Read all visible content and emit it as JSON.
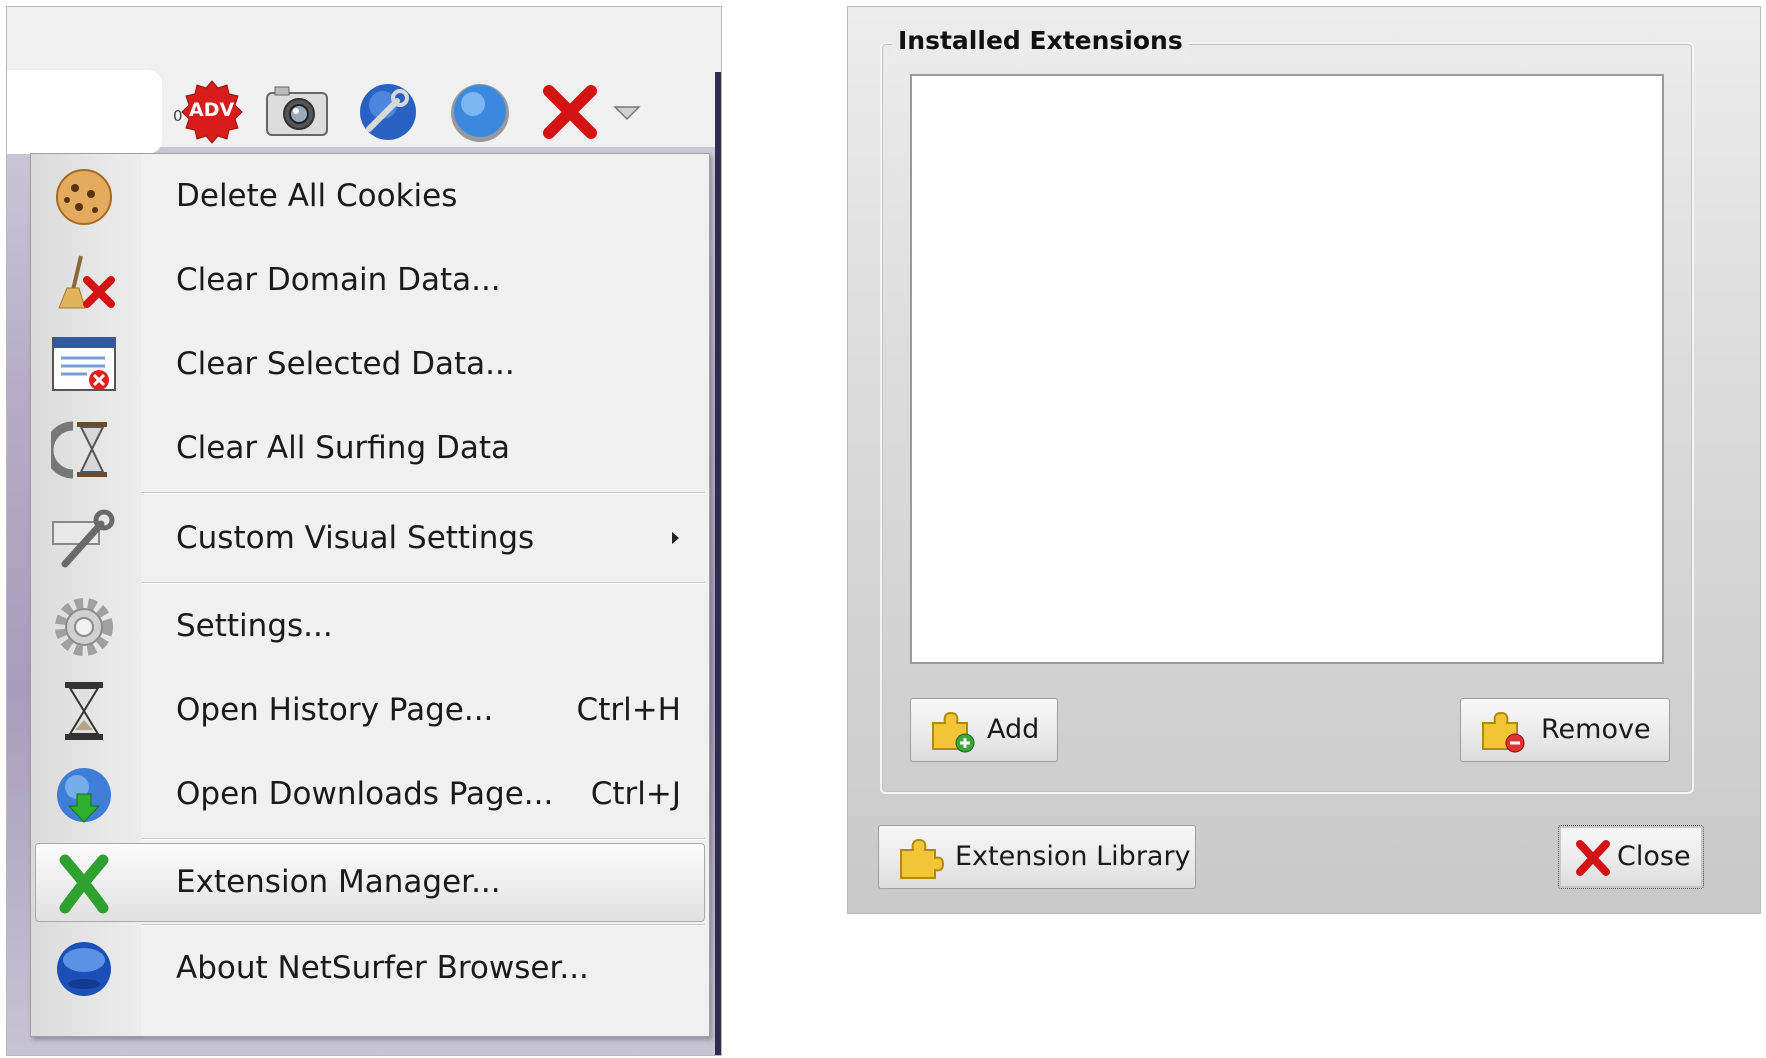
{
  "toolbar": {
    "adblock_count": "0",
    "adblock_badge": "ADV",
    "buttons": [
      "adblock-icon",
      "camera-icon",
      "tools-globe-icon",
      "globe-gear-icon",
      "red-x-icon",
      "dropdown-arrow-icon"
    ]
  },
  "menu": {
    "items": [
      {
        "label": "Delete All Cookies",
        "icon": "cookie-icon"
      },
      {
        "label": "Clear Domain Data...",
        "icon": "broom-x-icon"
      },
      {
        "label": "Clear Selected Data...",
        "icon": "window-x-icon"
      },
      {
        "label": "Clear All Surfing Data",
        "icon": "hourglass-refresh-icon"
      },
      {
        "label": "Custom Visual Settings",
        "icon": "wrench-icon",
        "submenu": true
      },
      {
        "label": "Settings...",
        "icon": "gear-icon"
      },
      {
        "label": "Open History Page...",
        "icon": "hourglass-icon",
        "shortcut": "Ctrl+H"
      },
      {
        "label": "Open Downloads Page...",
        "icon": "globe-download-icon",
        "shortcut": "Ctrl+J"
      },
      {
        "label": "Extension Manager...",
        "icon": "green-x-icon",
        "highlighted": true
      },
      {
        "label": "About NetSurfer Browser...",
        "icon": "blue-orb-icon"
      }
    ]
  },
  "dialog": {
    "group_title": "Installed Extensions",
    "add_label": "Add",
    "remove_label": "Remove",
    "library_label": "Extension Library",
    "close_label": "Close"
  },
  "colors": {
    "menu_bg": "#f0f0f0",
    "dialog_bg": "#dcdcdc",
    "accent_red": "#e01818",
    "accent_green": "#2ea12e"
  }
}
